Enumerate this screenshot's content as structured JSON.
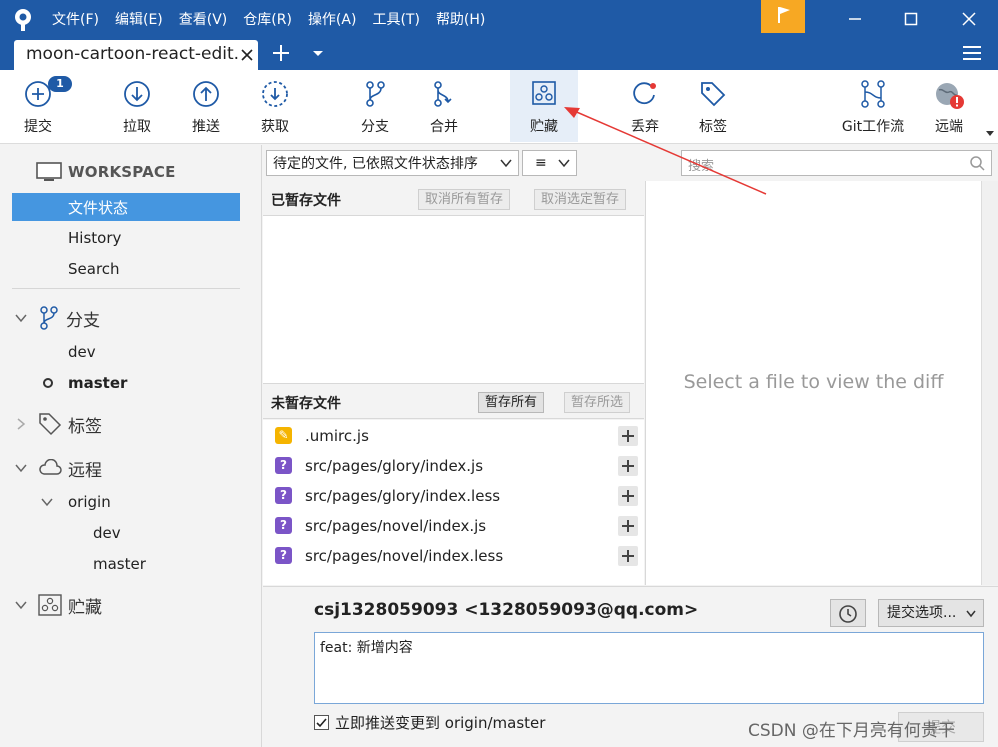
{
  "menu": [
    "文件(F)",
    "编辑(E)",
    "查看(V)",
    "仓库(R)",
    "操作(A)",
    "工具(T)",
    "帮助(H)"
  ],
  "tab": {
    "title": "moon-cartoon-react-edit."
  },
  "toolbar": {
    "commit": "提交",
    "commit_badge": "1",
    "pull": "拉取",
    "push": "推送",
    "fetch": "获取",
    "branch": "分支",
    "merge": "合并",
    "stash": "贮藏",
    "discard": "丢弃",
    "tag": "标签",
    "gitflow": "Git工作流",
    "remote": "远端"
  },
  "sidebar": {
    "workspace": "WORKSPACE",
    "file_status": "文件状态",
    "history": "History",
    "search": "Search",
    "branches": "分支",
    "branch_items": [
      "dev",
      "master"
    ],
    "tags": "标签",
    "remotes": "远程",
    "origin": "origin",
    "origin_items": [
      "dev",
      "master"
    ],
    "stashes": "贮藏"
  },
  "filter": {
    "sort_label": "待定的文件, 已依照文件状态排序",
    "view_icon": "≡",
    "search_placeholder": "搜索"
  },
  "staged": {
    "title": "已暂存文件",
    "unstage_all": "取消所有暂存",
    "unstage_selected": "取消选定暂存"
  },
  "unstaged": {
    "title": "未暂存文件",
    "stage_all": "暂存所有",
    "stage_selected": "暂存所选",
    "files": [
      {
        "name": ".umirc.js",
        "status": "modified",
        "icon": "✎"
      },
      {
        "name": "src/pages/glory/index.js",
        "status": "untracked",
        "icon": "?"
      },
      {
        "name": "src/pages/glory/index.less",
        "status": "untracked",
        "icon": "?"
      },
      {
        "name": "src/pages/novel/index.js",
        "status": "untracked",
        "icon": "?"
      },
      {
        "name": "src/pages/novel/index.less",
        "status": "untracked",
        "icon": "?"
      }
    ]
  },
  "diff": {
    "placeholder": "Select a file to view the diff"
  },
  "commit": {
    "author": "csj1328059093 <1328059093@qq.com>",
    "options": "提交选项...",
    "message": "feat: 新增内容",
    "push_label": "立即推送变更到 origin/master",
    "push_checked": true,
    "commit_button": "提交"
  },
  "watermark": "CSDN @在下月亮有何贵干",
  "colors": {
    "titlebar": "#1f5aa6",
    "selection": "#4596e0",
    "flag": "#f7a823",
    "annotation": "#e53935"
  }
}
